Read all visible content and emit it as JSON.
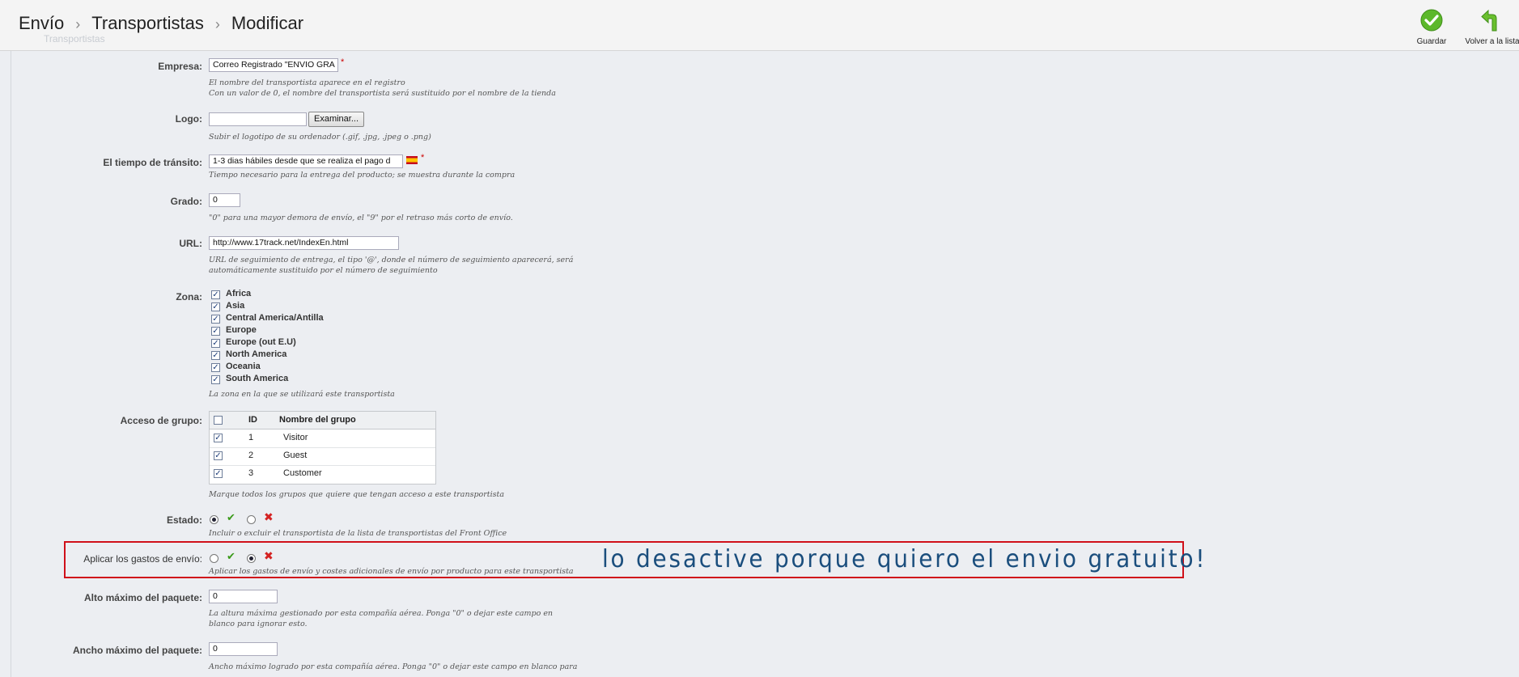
{
  "breadcrumb": {
    "items": [
      "Envío",
      "Transportistas",
      "Modificar"
    ],
    "subtitle": "Transportistas"
  },
  "toolbar": {
    "save_label": "Guardar",
    "back_label": "Volver a la lista"
  },
  "form": {
    "empresa": {
      "label": "Empresa:",
      "value": "Correo Registrado \"ENVIO GRA",
      "hint1": "El nombre del transportista aparece en el registro",
      "hint2": "Con un valor de 0, el nombre del transportista será sustituido por el nombre de la tienda"
    },
    "logo": {
      "label": "Logo:",
      "button": "Examinar...",
      "hint": "Subir el logotipo de su ordenador (.gif, .jpg, .jpeg o .png)"
    },
    "transito": {
      "label": "El tiempo de tránsito:",
      "value": "1-3 dias  hábiles desde que se realiza el pago d",
      "hint": "Tiempo necesario para la entrega del producto; se muestra durante la compra"
    },
    "grado": {
      "label": "Grado:",
      "value": "0",
      "hint": "\"0\" para una mayor demora de envío, el \"9\" por el retraso más corto de envío."
    },
    "url": {
      "label": "URL:",
      "value": "http://www.17track.net/IndexEn.html",
      "hint1": "URL de seguimiento de entrega, el tipo '@', donde el número de seguimiento aparecerá, será",
      "hint2": "automáticamente sustituido por el número de seguimiento"
    },
    "zona": {
      "label": "Zona:",
      "items": [
        "Africa",
        "Asia",
        "Central America/Antilla",
        "Europe",
        "Europe (out E.U)",
        "North America",
        "Oceania",
        "South America"
      ],
      "hint": "La zona en la que se utilizará este transportista"
    },
    "grupo": {
      "label": "Acceso de grupo:",
      "columns": [
        "ID",
        "Nombre del grupo"
      ],
      "rows": [
        {
          "id": "1",
          "name": "Visitor"
        },
        {
          "id": "2",
          "name": "Guest"
        },
        {
          "id": "3",
          "name": "Customer"
        }
      ],
      "hint": "Marque todos los grupos que quiere que tengan acceso a este transportista"
    },
    "estado": {
      "label": "Estado:",
      "hint": "Incluir o excluir el transportista de la lista de transportistas del Front Office"
    },
    "gastos": {
      "label": "Aplicar los gastos de envío:",
      "hint": "Aplicar los gastos de envío y costes adicionales de envío por producto para este transportista"
    },
    "alto": {
      "label": "Alto máximo del paquete:",
      "value": "0",
      "hint1": "La altura máxima gestionado por esta compañía aérea. Ponga \"0\" o dejar este campo en",
      "hint2": "blanco para ignorar esto."
    },
    "ancho": {
      "label": "Ancho máximo del paquete:",
      "value": "0",
      "hint": "Ancho máximo logrado por esta compañía aérea. Ponga \"0\" o dejar este campo en blanco para"
    }
  },
  "annotation": "lo desactive porque quiero el envio gratuito!",
  "colors": {
    "annotation_box": "#d0101a",
    "annotation_text": "#1b4e7d",
    "save_green": "#5cb82a",
    "error_red": "#d42222"
  }
}
